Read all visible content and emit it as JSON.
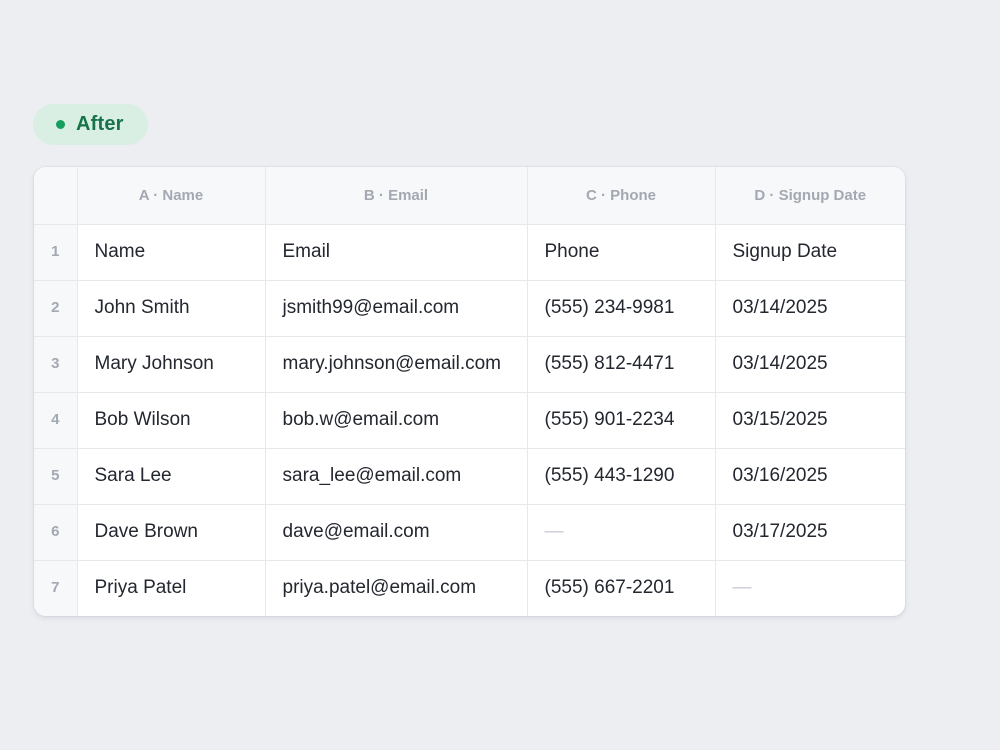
{
  "badge": {
    "label": "After",
    "dot_color": "#17a05d"
  },
  "columns": [
    {
      "header": "A · Name"
    },
    {
      "header": "B · Email"
    },
    {
      "header": "C · Phone"
    },
    {
      "header": "D · Signup Date"
    }
  ],
  "rows": [
    {
      "num": "1",
      "name": "Name",
      "email": "Email",
      "phone": "Phone",
      "signup_date": "Signup Date"
    },
    {
      "num": "2",
      "name": "John Smith",
      "email": "jsmith99@email.com",
      "phone": "(555) 234-9981",
      "signup_date": "03/14/2025"
    },
    {
      "num": "3",
      "name": "Mary Johnson",
      "email": "mary.johnson@email.com",
      "phone": "(555) 812-4471",
      "signup_date": "03/14/2025"
    },
    {
      "num": "4",
      "name": "Bob Wilson",
      "email": "bob.w@email.com",
      "phone": "(555) 901-2234",
      "signup_date": "03/15/2025"
    },
    {
      "num": "5",
      "name": "Sara Lee",
      "email": "sara_lee@email.com",
      "phone": "(555) 443-1290",
      "signup_date": "03/16/2025"
    },
    {
      "num": "6",
      "name": "Dave Brown",
      "email": "dave@email.com",
      "phone": "—",
      "signup_date": "03/17/2025"
    },
    {
      "num": "7",
      "name": "Priya Patel",
      "email": "priya.patel@email.com",
      "phone": "(555) 667-2201",
      "signup_date": "—"
    }
  ]
}
